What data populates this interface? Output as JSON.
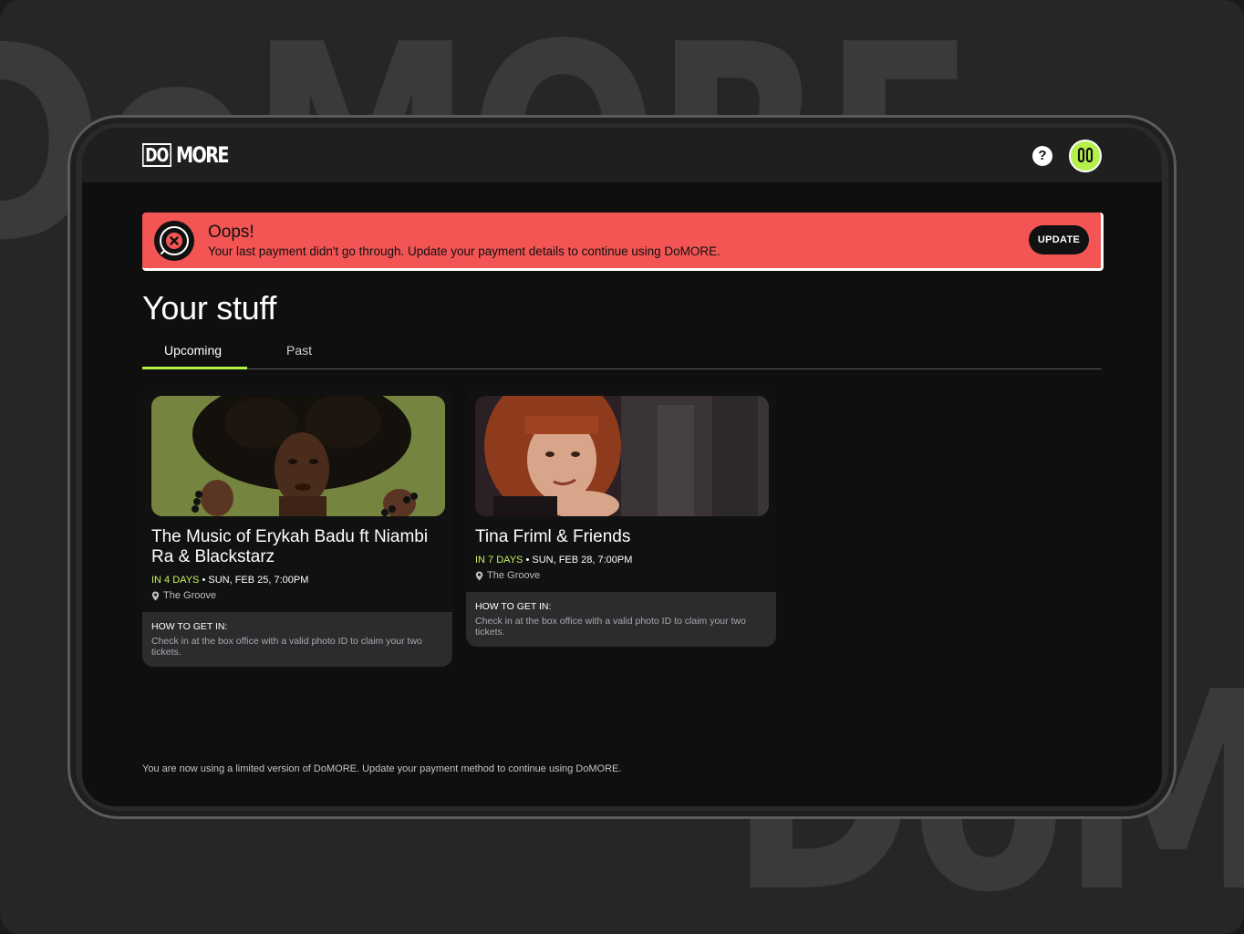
{
  "background": {
    "watermark_top": "DoMORE",
    "watermark_bottom": "DoMORE"
  },
  "header": {
    "logo_do": "DO",
    "logo_more": "MORE",
    "help_symbol": "?",
    "icons": {
      "help": "question-circle-icon",
      "avatar": "smiley-avatar-icon"
    }
  },
  "alert": {
    "icon": "error-x-icon",
    "title": "Oops!",
    "message": "Your last payment didn't go through. Update your payment details to continue using DoMORE.",
    "button_label": "UPDATE",
    "color": "#f35454"
  },
  "main": {
    "title": "Your stuff",
    "tabs": [
      {
        "label": "Upcoming",
        "active": true
      },
      {
        "label": "Past",
        "active": false
      }
    ],
    "accent_color": "#b6f04a"
  },
  "events": [
    {
      "title": "The Music of Erykah Badu ft Niambi Ra & Blackstarz",
      "countdown": "IN 4 DAYS",
      "separator": "•",
      "datetime": "SUN, FEB 25, 7:00PM",
      "venue": "The Groove",
      "how_to_label": "HOW TO GET IN:",
      "instructions": "Check in at the box office with a valid photo ID to claim your two tickets."
    },
    {
      "title": "Tina Friml & Friends",
      "countdown": "IN 7 DAYS",
      "separator": "•",
      "datetime": "SUN, FEB 28, 7:00PM",
      "venue": "The Groove",
      "how_to_label": "HOW TO GET IN:",
      "instructions": "Check in at the box office with a valid photo ID to claim your two tickets."
    }
  ],
  "footer": {
    "note": "You are now using a limited version of DoMORE. Update your payment method to continue using DoMORE."
  }
}
